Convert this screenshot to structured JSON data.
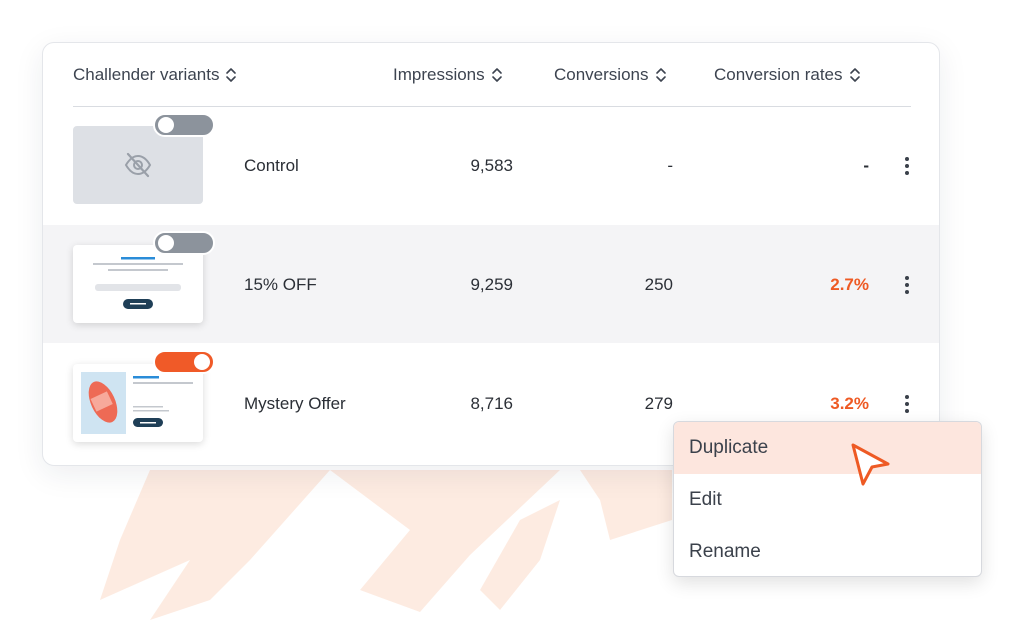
{
  "table": {
    "columns": [
      "Challender variants",
      "Impressions",
      "Conversions",
      "Conversion rates"
    ],
    "rows": [
      {
        "variant": "Control",
        "impressions": "9,583",
        "conversions": "-",
        "rate": "-",
        "enabled": false,
        "thumbnail_icon": "eye-off-icon"
      },
      {
        "variant": "15% OFF",
        "impressions": "9,259",
        "conversions": "250",
        "rate": "2.7%",
        "enabled": false
      },
      {
        "variant": "Mystery Offer",
        "impressions": "8,716",
        "conversions": "279",
        "rate": "3.2%",
        "enabled": true
      }
    ]
  },
  "context_menu": {
    "items": [
      "Duplicate",
      "Edit",
      "Rename"
    ],
    "highlighted": "Duplicate"
  },
  "colors": {
    "accent": "#ee5a24",
    "toggle_off": "#8c939c",
    "row_shade": "#f4f4f6",
    "menu_highlight": "#fde6de"
  }
}
